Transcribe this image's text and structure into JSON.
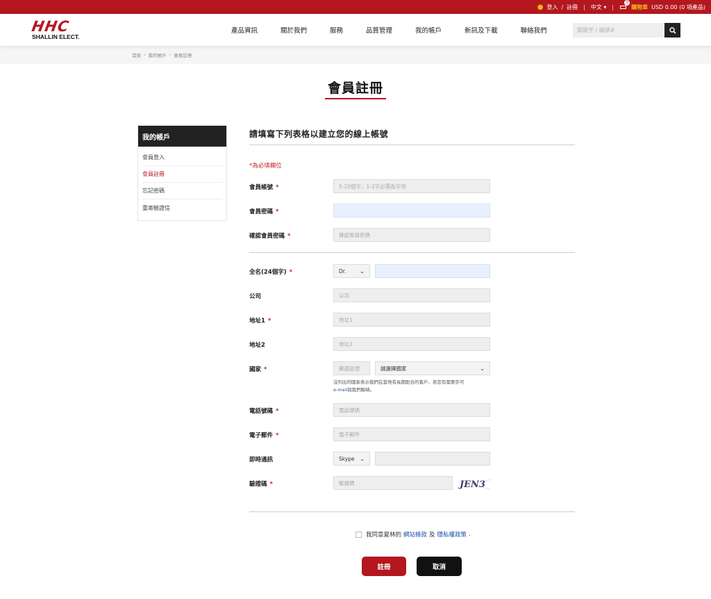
{
  "topbar": {
    "login": "登入",
    "slash": "/",
    "register": "註冊",
    "sep": "|",
    "language": "中文",
    "language_caret": "▾",
    "cart_count": "0",
    "cart_label": "購物車",
    "cart_total": "USD 0.00 (0 項產品)"
  },
  "header": {
    "logo_mark": "HHC",
    "logo_text": "SHALLIN ELECT.",
    "nav": [
      "產品資訊",
      "關於我們",
      "服務",
      "品質管理",
      "我的帳戶",
      "新訊及下載",
      "聯絡我們"
    ],
    "search_placeholder": "關鍵字 / 編號#"
  },
  "breadcrumb": [
    "首頁",
    "›",
    "我的帳戶",
    "›",
    "會員註冊"
  ],
  "page_title": "會員註冊",
  "sidebar": {
    "title": "我的帳戶",
    "items": [
      "會員登入",
      "會員註冊",
      "忘記密碼",
      "重寄驗證信"
    ]
  },
  "form": {
    "heading": "請填寫下列表格以建立您的線上帳號",
    "required_note": "*為必填欄位",
    "star": "*",
    "account_label": "會員帳號",
    "account_placeholder": "5-20個字，1-2字必需為字母",
    "password_label": "會員密碼",
    "confirm_label": "確認會員密碼",
    "confirm_placeholder": "確認會員密碼",
    "fullname_label": "全名(24個字)",
    "title_value": "Dr.",
    "company_label": "公司",
    "company_placeholder": "公司",
    "address1_label": "地址1",
    "address1_placeholder": "地址1",
    "address2_label": "地址2",
    "address2_placeholder": "地址2",
    "country_label": "國家",
    "country_code_placeholder": "郵遞區號",
    "country_select": "請選擇國家",
    "country_note_line1": "沒列出的國家表示我們在當地有長期配合的客戶，若您有需要亦可",
    "country_note_email": "e-mail",
    "country_note_line2": "與我們聯絡。",
    "phone_label": "電話號碼",
    "phone_placeholder": "電話號碼",
    "email_label": "電子郵件",
    "email_placeholder": "電子郵件",
    "im_label": "即時通訊",
    "im_value": "Skype",
    "captcha_label": "驗證碼",
    "captcha_placeholder": "驗證碼",
    "captcha_text": "JEN3",
    "agree_prefix": "我同意夏林的",
    "agree_terms": "網站條款",
    "agree_and": "及",
    "agree_privacy": "隱私權政策",
    "agree_suffix": ".",
    "submit": "註冊",
    "cancel": "取消"
  },
  "colors": {
    "brand_red": "#b4171e",
    "dark": "#222222",
    "link_blue": "#1d4fa8"
  }
}
